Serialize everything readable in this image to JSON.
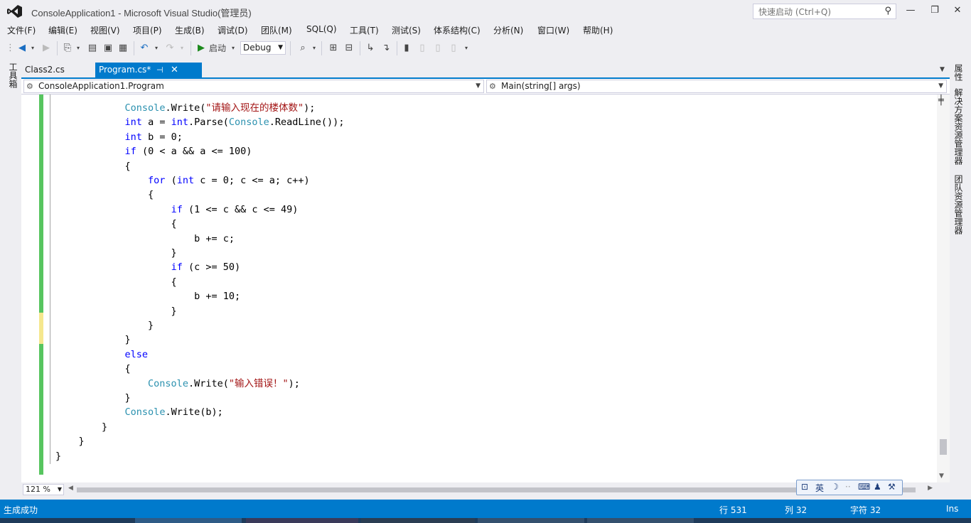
{
  "window": {
    "title": "ConsoleApplication1 - Microsoft Visual Studio(管理员)",
    "quick_launch_placeholder": "快速启动 (Ctrl+Q)"
  },
  "menu": [
    "文件(F)",
    "编辑(E)",
    "视图(V)",
    "项目(P)",
    "生成(B)",
    "调试(D)",
    "团队(M)",
    "SQL(Q)",
    "工具(T)",
    "测试(S)",
    "体系结构(C)",
    "分析(N)",
    "窗口(W)",
    "帮助(H)"
  ],
  "toolbar": {
    "start_label": "启动",
    "config_value": "Debug"
  },
  "side_panels": {
    "left": "工具箱",
    "right": [
      "属性",
      "解决方案资源管理器",
      "团队资源管理器"
    ]
  },
  "tabs": [
    {
      "label": "Class2.cs",
      "active": false
    },
    {
      "label": "Program.cs*",
      "active": true
    }
  ],
  "navigation": {
    "type_scope": "ConsoleApplication1.Program",
    "member_scope": "Main(string[] args)"
  },
  "code_lines": [
    "            Console.Write(\"请输入现在的楼体数\");",
    "            int a = int.Parse(Console.ReadLine());",
    "            int b = 0;",
    "            if (0 < a && a <= 100)",
    "            {",
    "                for (int c = 0; c <= a; c++)",
    "                {",
    "                    if (1 <= c && c <= 49)",
    "                    {",
    "                        b += c;",
    "                    }",
    "                    if (c >= 50)",
    "                    {",
    "                        b += 10;",
    "                    }",
    "                }",
    "            }",
    "            else",
    "            {",
    "                Console.Write(\"输入错误！\");",
    "            }",
    "            Console.Write(b);",
    "        }",
    "    }",
    "}"
  ],
  "editor": {
    "zoom": "121 %"
  },
  "ime": {
    "mode": "英"
  },
  "status": {
    "message": "生成成功",
    "line": "行 531",
    "column": "列 32",
    "char": "字符 32",
    "insert_mode": "Ins"
  },
  "colors": {
    "accent": "#007acc",
    "keyword": "#0000ff",
    "type": "#2b91af",
    "string": "#a31515",
    "change_saved": "#57c55f",
    "change_unsaved": "#f5e78e"
  }
}
